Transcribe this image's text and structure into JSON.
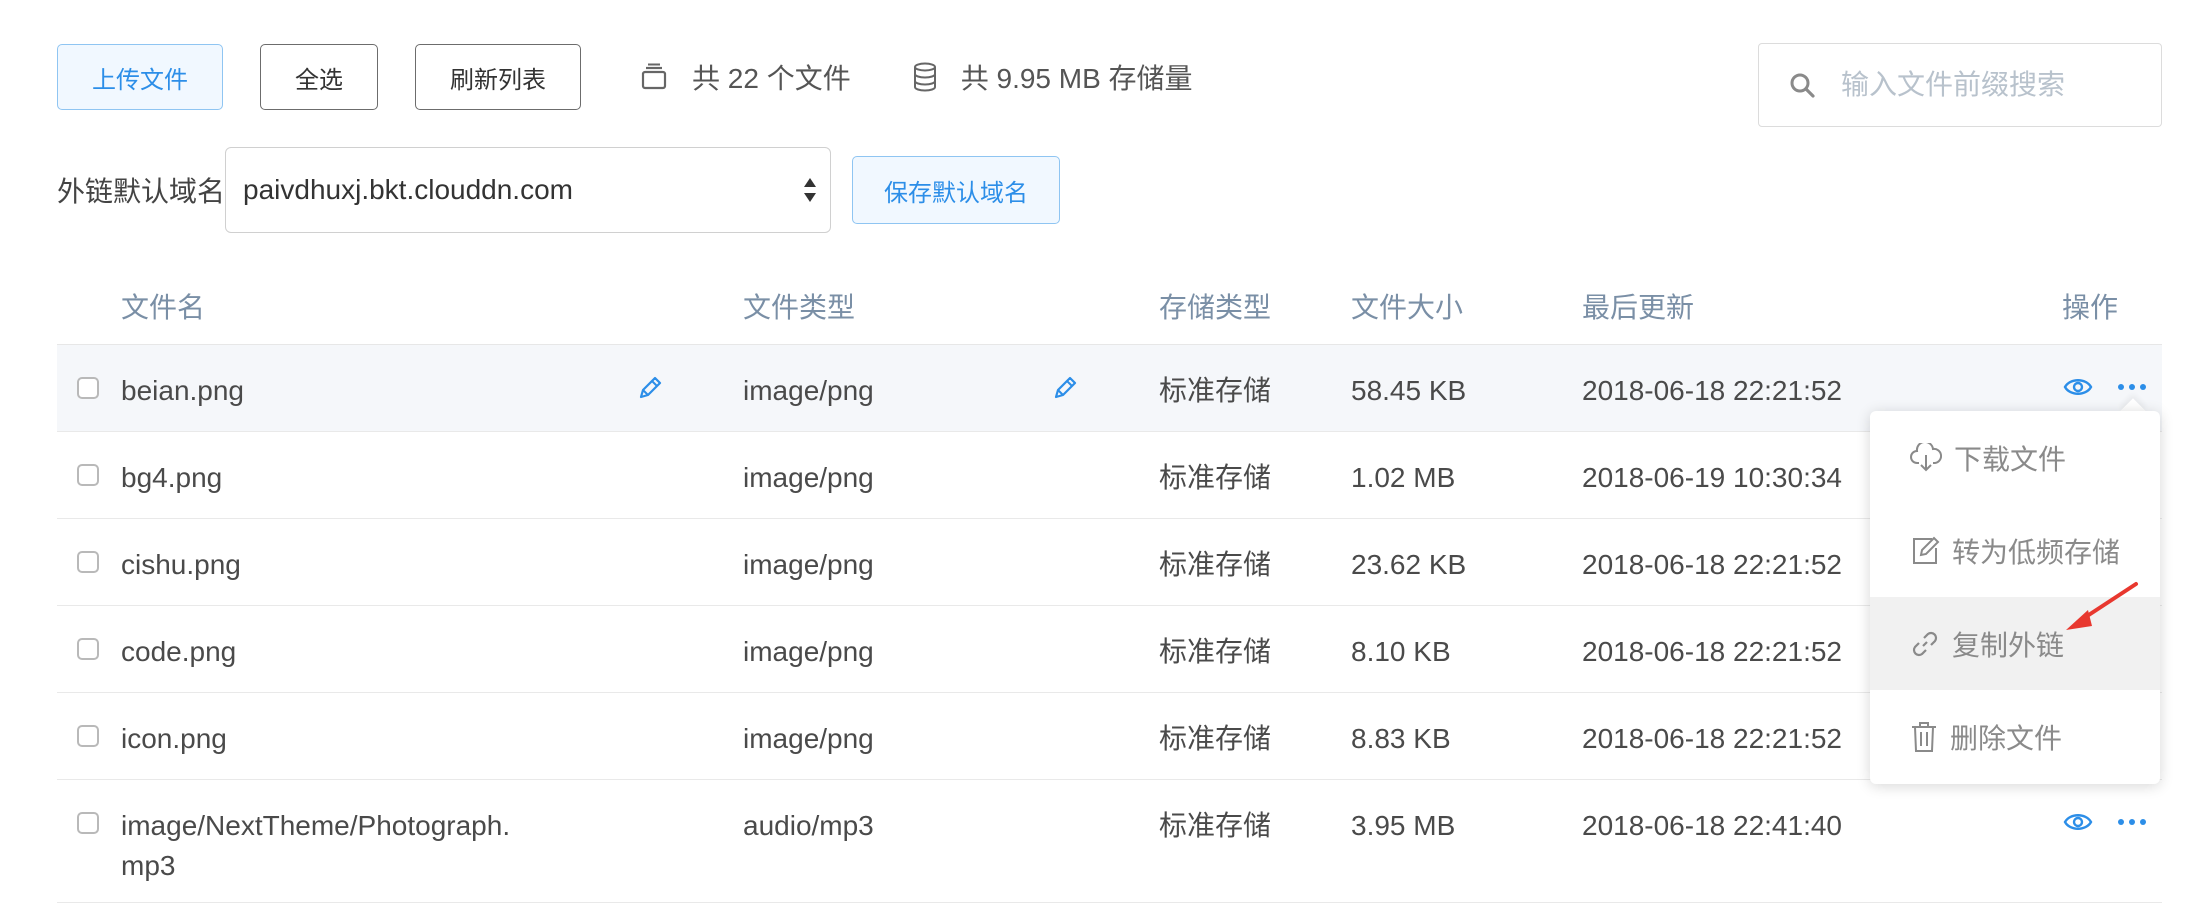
{
  "toolbar": {
    "upload_label": "上传文件",
    "select_all_label": "全选",
    "refresh_label": "刷新列表",
    "file_count_text": "共 22 个文件",
    "storage_text": "共 9.95 MB 存储量"
  },
  "search": {
    "placeholder": "输入文件前缀搜索"
  },
  "domain": {
    "label": "外链默认域名",
    "value": "paivdhuxj.bkt.clouddn.com",
    "save_label": "保存默认域名"
  },
  "table": {
    "headers": {
      "name": "文件名",
      "type": "文件类型",
      "storage": "存储类型",
      "size": "文件大小",
      "updated": "最后更新",
      "actions": "操作"
    },
    "rows": [
      {
        "name": "beian.png",
        "type": "image/png",
        "storage": "标准存储",
        "size": "58.45 KB",
        "updated": "2018-06-18 22:21:52"
      },
      {
        "name": "bg4.png",
        "type": "image/png",
        "storage": "标准存储",
        "size": "1.02 MB",
        "updated": "2018-06-19 10:30:34"
      },
      {
        "name": "cishu.png",
        "type": "image/png",
        "storage": "标准存储",
        "size": "23.62 KB",
        "updated": "2018-06-18 22:21:52"
      },
      {
        "name": "code.png",
        "type": "image/png",
        "storage": "标准存储",
        "size": "8.10 KB",
        "updated": "2018-06-18 22:21:52"
      },
      {
        "name": "icon.png",
        "type": "image/png",
        "storage": "标准存储",
        "size": "8.83 KB",
        "updated": "2018-06-18 22:21:52"
      },
      {
        "name_line1": "image/NextTheme/Photograph.",
        "name_line2": "mp3",
        "type": "audio/mp3",
        "storage": "标准存储",
        "size": "3.95 MB",
        "updated": "2018-06-18 22:41:40"
      }
    ]
  },
  "menu": {
    "download": "下载文件",
    "convert": "转为低频存储",
    "copy_link": "复制外链",
    "delete": "删除文件"
  },
  "colors": {
    "accent": "#2c8ee8",
    "arrow": "#e8382f",
    "header_text": "#7a8fa6"
  }
}
